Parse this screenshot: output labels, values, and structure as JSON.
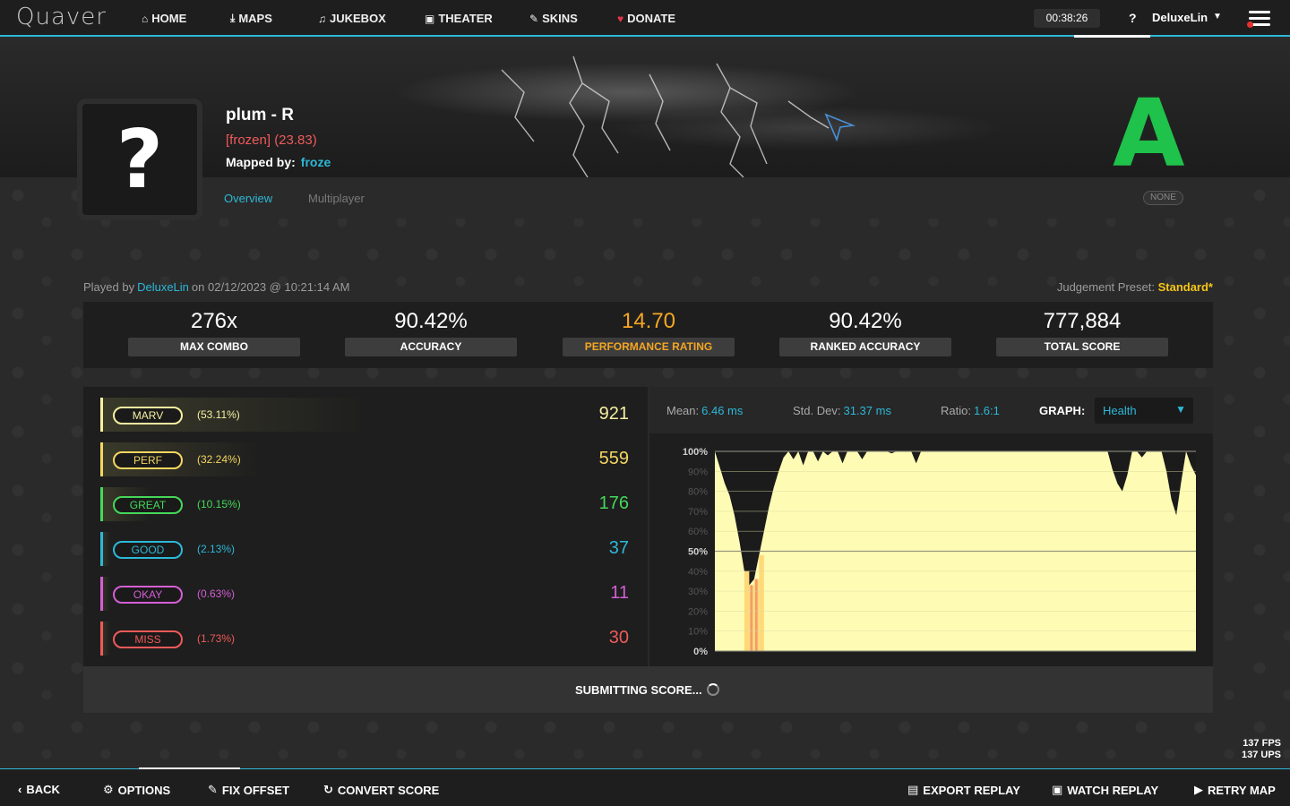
{
  "app": {
    "logo": "Quaver"
  },
  "nav": {
    "items": [
      {
        "icon": "⌂",
        "label": "HOME"
      },
      {
        "icon": "⤓",
        "label": "MAPS"
      },
      {
        "icon": "♫",
        "label": "JUKEBOX"
      },
      {
        "icon": "▣",
        "label": "THEATER"
      },
      {
        "icon": "✎",
        "label": "SKINS"
      },
      {
        "icon": "♥",
        "label": "DONATE"
      }
    ],
    "clock": "00:38:26",
    "help": "?",
    "username": "DeluxeLin"
  },
  "song": {
    "title": "plum - R",
    "difficulty": "[frozen] (23.83)",
    "mapped_by_label": "Mapped by:",
    "mapper": "froze",
    "cover_placeholder": "?",
    "grade": "A"
  },
  "tabs": {
    "overview": "Overview",
    "multiplayer": "Multiplayer",
    "mods": "NONE"
  },
  "play_info": {
    "prefix": "Played by",
    "player": "DeluxeLin",
    "suffix": "on 02/12/2023 @ 10:21:14 AM",
    "preset_label": "Judgement Preset:",
    "preset_value": "Standard*"
  },
  "stats": [
    {
      "value": "276x",
      "label": "MAX COMBO"
    },
    {
      "value": "90.42%",
      "label": "ACCURACY"
    },
    {
      "value": "14.70",
      "label": "PERFORMANCE RATING"
    },
    {
      "value": "90.42%",
      "label": "RANKED ACCURACY"
    },
    {
      "value": "777,884",
      "label": "TOTAL SCORE"
    }
  ],
  "judgements": [
    {
      "name": "MARV",
      "pct": "(53.11%)",
      "count": "921",
      "color": "#f5f0a0",
      "fill": 0.53
    },
    {
      "name": "PERF",
      "pct": "(32.24%)",
      "count": "559",
      "color": "#f5d660",
      "fill": 0.32
    },
    {
      "name": "GREAT",
      "pct": "(10.15%)",
      "count": "176",
      "color": "#45d85a",
      "fill": 0.1
    },
    {
      "name": "GOOD",
      "pct": "(2.13%)",
      "count": "37",
      "color": "#2db8d8",
      "fill": 0.02
    },
    {
      "name": "OKAY",
      "pct": "(0.63%)",
      "count": "11",
      "color": "#d45fd4",
      "fill": 0.01
    },
    {
      "name": "MISS",
      "pct": "(1.73%)",
      "count": "30",
      "color": "#f05a5a",
      "fill": 0.02
    }
  ],
  "graph": {
    "mean_label": "Mean:",
    "mean": "6.46 ms",
    "std_label": "Std. Dev:",
    "std": "31.37 ms",
    "ratio_label": "Ratio:",
    "ratio": "1.6:1",
    "graph_label": "GRAPH:",
    "graph_type": "Health"
  },
  "chart_data": {
    "type": "area",
    "title": "",
    "ylabel": "",
    "ylim": [
      0,
      100
    ],
    "y_ticks": [
      "100%",
      "90%",
      "80%",
      "70%",
      "60%",
      "50%",
      "40%",
      "30%",
      "20%",
      "10%",
      "0%"
    ],
    "series": [
      {
        "values": [
          100,
          92,
          84,
          78,
          68,
          55,
          40,
          33,
          36,
          48,
          60,
          72,
          82,
          90,
          97,
          100,
          96,
          100,
          93,
          100,
          100,
          95,
          100,
          98,
          100,
          100,
          94,
          100,
          100,
          100,
          96,
          100,
          100,
          100,
          100,
          100,
          99,
          100,
          100,
          100,
          100,
          94,
          100,
          100,
          100,
          100,
          100,
          100,
          100,
          100,
          100,
          100,
          100,
          100,
          100,
          100,
          100,
          100,
          100,
          100,
          100,
          100,
          100,
          100,
          100,
          100,
          100,
          100,
          100,
          100,
          100,
          100,
          100,
          100,
          100,
          100,
          100,
          100,
          100,
          100,
          100,
          91,
          84,
          80,
          88,
          100,
          100,
          97,
          100,
          100,
          100,
          100,
          90,
          76,
          68,
          85,
          100,
          93,
          88
        ]
      }
    ],
    "colors": {
      "fill": "#fefcb4",
      "warn": "#ffd978",
      "danger": "#f39a6e",
      "background": "#1b1b1b"
    }
  },
  "submit": {
    "text": "SUBMITTING SCORE..."
  },
  "fps": {
    "fps": "137 FPS",
    "ups": "137 UPS"
  },
  "bottom": {
    "back": "BACK",
    "options": "OPTIONS",
    "fix_offset": "FIX OFFSET",
    "convert_score": "CONVERT SCORE",
    "export_replay": "EXPORT REPLAY",
    "watch_replay": "WATCH REPLAY",
    "retry_map": "RETRY MAP"
  }
}
